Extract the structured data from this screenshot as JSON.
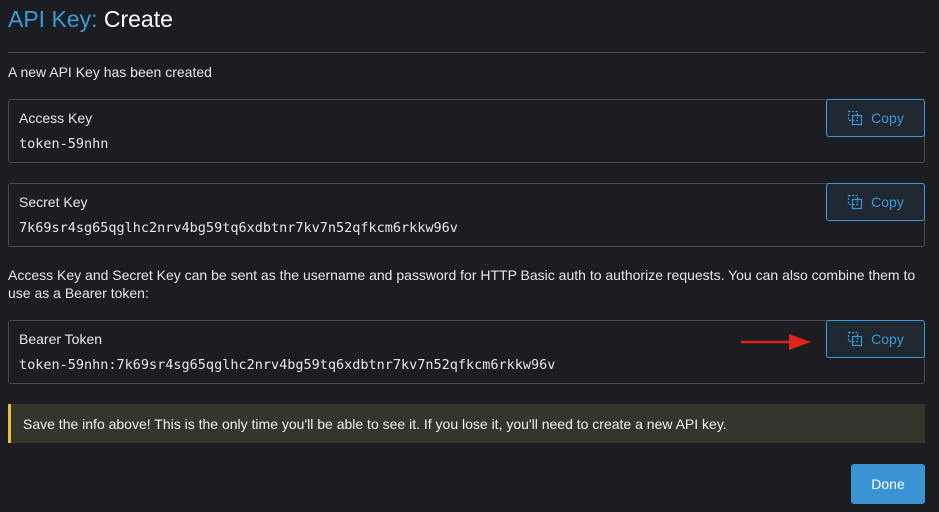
{
  "header": {
    "title_prefix": "API Key:",
    "title_main": "Create"
  },
  "intro_text": "A new API Key has been created",
  "access_key": {
    "label": "Access Key",
    "value": "token-59nhn",
    "copy_label": "Copy"
  },
  "secret_key": {
    "label": "Secret Key",
    "value": "7k69sr4sg65qglhc2nrv4bg59tq6xdbtnr7kv7n52qfkcm6rkkw96v",
    "copy_label": "Copy"
  },
  "explanation": "Access Key and Secret Key can be sent as the username and password for HTTP Basic auth to authorize requests. You can also combine them to use as a Bearer token:",
  "bearer_token": {
    "label": "Bearer Token",
    "value": "token-59nhn:7k69sr4sg65qglhc2nrv4bg59tq6xdbtnr7kv7n52qfkcm6rkkw96v",
    "copy_label": "Copy"
  },
  "warning_text": "Save the info above! This is the only time you'll be able to see it. If you lose it, you'll need to create a new API key.",
  "done_label": "Done",
  "colors": {
    "accent": "#3b9bd8",
    "warning_border": "#e8c33a",
    "arrow": "#e0241b",
    "background": "#1c1d22"
  },
  "icons": {
    "copy": "copy-icon",
    "annotation": "red-arrow-icon"
  }
}
